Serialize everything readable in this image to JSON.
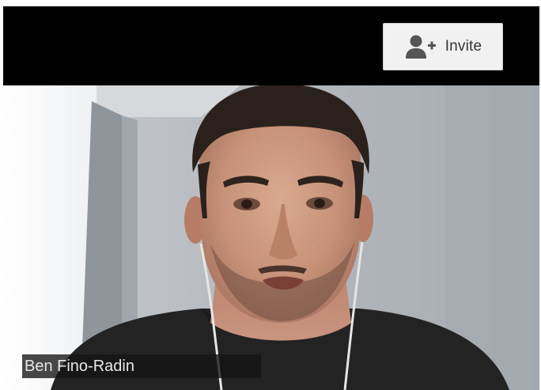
{
  "toolbar": {
    "invite_label": "Invite",
    "invite_icon": "add-person-icon"
  },
  "participant": {
    "name": "Ben Fino-Radin"
  },
  "colors": {
    "bar_background": "#000000",
    "button_background": "#f1f1f1",
    "button_text": "#333333",
    "name_tag_background": "#141414"
  }
}
